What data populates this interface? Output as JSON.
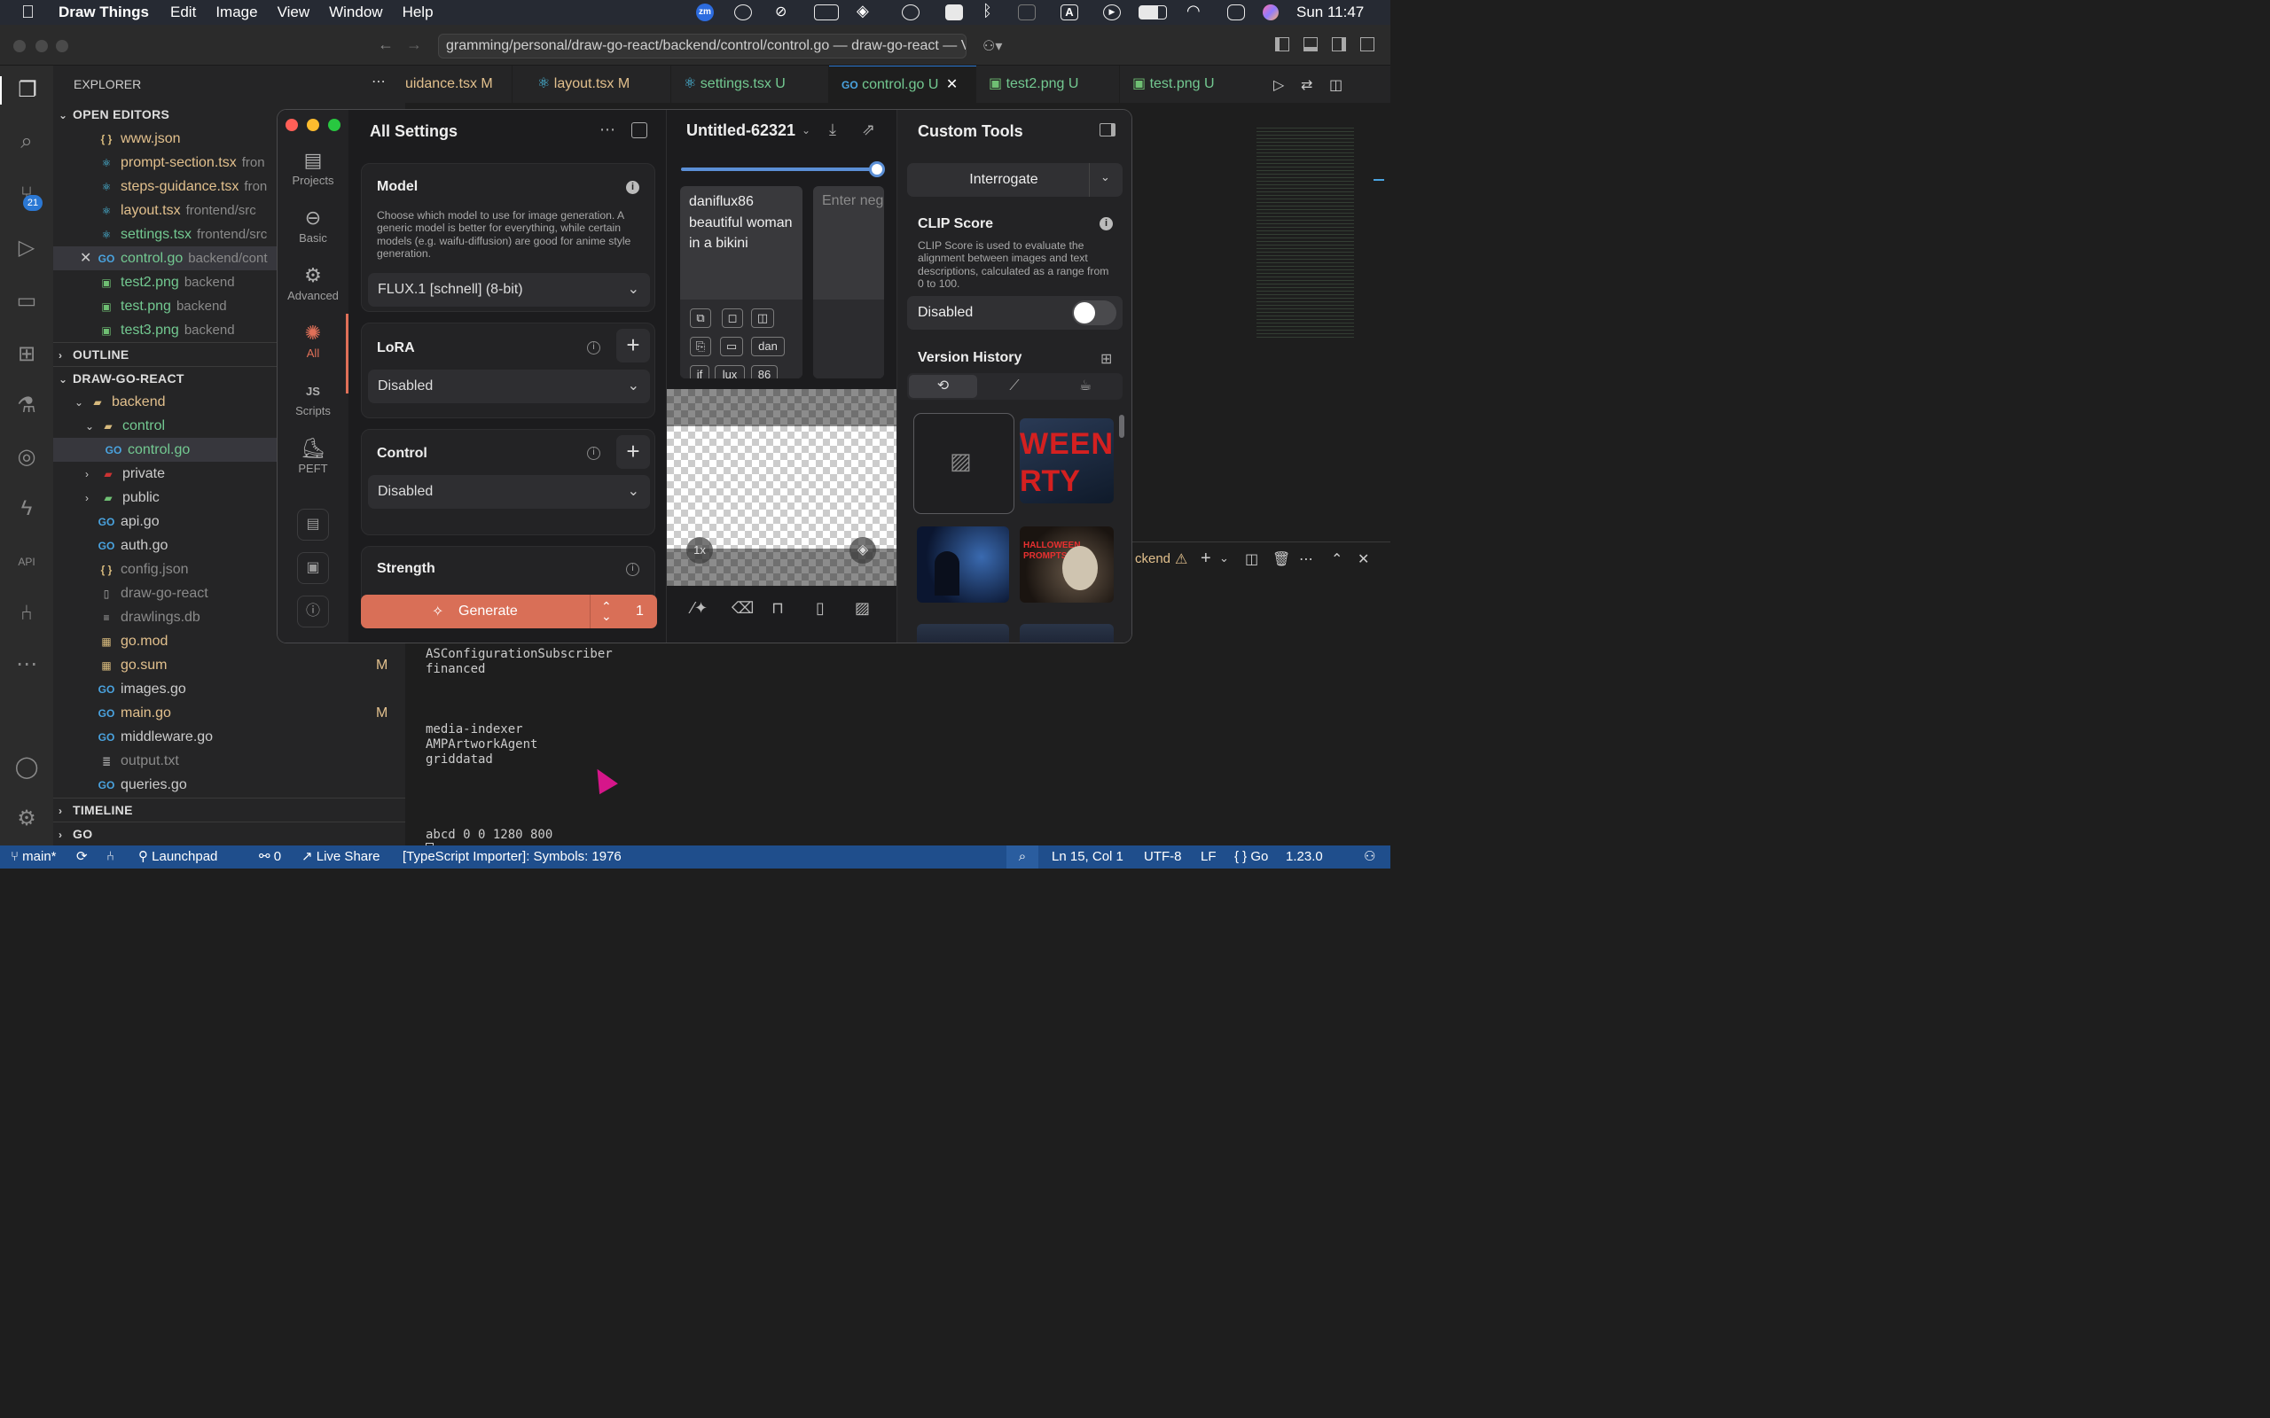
{
  "menubar": {
    "app_name": "Draw Things",
    "items": [
      "Edit",
      "Image",
      "View",
      "Window",
      "Help"
    ],
    "clock": "Sun 11:47",
    "zoom_badge": "zm"
  },
  "vscode": {
    "title": "gramming/personal/draw-go-react/backend/control/control.go — draw-go-react — Visu",
    "scm_badge": "21",
    "explorer_title": "EXPLORER",
    "open_editors_title": "OPEN EDITORS",
    "open_editors": [
      {
        "name": "www.json",
        "type": "json",
        "path": ""
      },
      {
        "name": "prompt-section.tsx",
        "type": "react",
        "path": "fron"
      },
      {
        "name": "steps-guidance.tsx",
        "type": "react",
        "path": "fron"
      },
      {
        "name": "layout.tsx",
        "type": "react",
        "path": "frontend/src"
      },
      {
        "name": "settings.tsx",
        "type": "react",
        "path": "frontend/src"
      },
      {
        "name": "control.go",
        "type": "go",
        "path": "backend/cont"
      },
      {
        "name": "test2.png",
        "type": "image",
        "path": "backend"
      },
      {
        "name": "test.png",
        "type": "image",
        "path": "backend"
      },
      {
        "name": "test3.png",
        "type": "image",
        "path": "backend"
      }
    ],
    "outline_title": "OUTLINE",
    "project_title": "DRAW-GO-REACT",
    "tree": [
      {
        "name": "backend",
        "kind": "folder-open",
        "depth": 1,
        "badge": ""
      },
      {
        "name": "control",
        "kind": "folder-open",
        "depth": 2,
        "badge": ""
      },
      {
        "name": "control.go",
        "kind": "go",
        "depth": 3,
        "badge": ""
      },
      {
        "name": "private",
        "kind": "folder",
        "depth": 2,
        "badge": ""
      },
      {
        "name": "public",
        "kind": "folder",
        "depth": 2,
        "badge": ""
      },
      {
        "name": "api.go",
        "kind": "go",
        "depth": 2,
        "badge": ""
      },
      {
        "name": "auth.go",
        "kind": "go",
        "depth": 2,
        "badge": ""
      },
      {
        "name": "config.json",
        "kind": "json",
        "depth": 2,
        "badge": ""
      },
      {
        "name": "draw-go-react",
        "kind": "file",
        "depth": 2,
        "badge": ""
      },
      {
        "name": "drawlings.db",
        "kind": "db",
        "depth": 2,
        "badge": ""
      },
      {
        "name": "go.mod",
        "kind": "gomod",
        "depth": 2,
        "badge": ""
      },
      {
        "name": "go.sum",
        "kind": "gomod",
        "depth": 2,
        "badge": "M"
      },
      {
        "name": "images.go",
        "kind": "go",
        "depth": 2,
        "badge": ""
      },
      {
        "name": "main.go",
        "kind": "go",
        "depth": 2,
        "badge": "M"
      },
      {
        "name": "middleware.go",
        "kind": "go",
        "depth": 2,
        "badge": ""
      },
      {
        "name": "output.txt",
        "kind": "file",
        "depth": 2,
        "badge": ""
      },
      {
        "name": "queries.go",
        "kind": "go",
        "depth": 2,
        "badge": ""
      }
    ],
    "timeline_title": "TIMELINE",
    "go_title": "GO",
    "tabs": [
      {
        "label": "uidance.tsx",
        "badge": "M",
        "type": "react"
      },
      {
        "label": "layout.tsx",
        "badge": "M",
        "type": "react"
      },
      {
        "label": "settings.tsx",
        "badge": "U",
        "type": "react"
      },
      {
        "label": "control.go",
        "badge": "U",
        "type": "go"
      },
      {
        "label": "test2.png",
        "badge": "U",
        "type": "image"
      },
      {
        "label": "test.png",
        "badge": "U",
        "type": "image"
      }
    ],
    "terminal_tab": "ckend",
    "terminal_lines": [
      "ASConfigurationSubscriber",
      "financed",
      "",
      "",
      "",
      "media-indexer",
      "AMPArtworkAgent",
      "griddatad",
      "",
      "",
      "",
      "",
      "abcd 0 0 1280 800"
    ],
    "status": {
      "branch": "main*",
      "launchpad": "Launchpad",
      "ports": "0",
      "live_share": "Live Share",
      "importer": "[TypeScript Importer]: Symbols: 1976",
      "position": "Ln 15, Col 1",
      "encoding": "UTF-8",
      "eol": "LF",
      "language": "Go",
      "version": "1.23.0"
    }
  },
  "drawthings": {
    "rail": [
      {
        "label": "Projects",
        "icon": "projects-icon"
      },
      {
        "label": "Basic",
        "icon": "basic-icon"
      },
      {
        "label": "Advanced",
        "icon": "advanced-icon"
      },
      {
        "label": "All",
        "icon": "all-icon"
      },
      {
        "label": "Scripts",
        "icon": "scripts-icon"
      },
      {
        "label": "PEFT",
        "icon": "peft-icon"
      }
    ],
    "settings_title": "All Settings",
    "model": {
      "title": "Model",
      "description": "Choose which model to use for image generation. A generic model is better for everything, while certain models (e.g. waifu-diffusion) are good for anime style generation.",
      "value": "FLUX.1 [schnell] (8-bit)"
    },
    "lora": {
      "title": "LoRA",
      "value": "Disabled"
    },
    "control": {
      "title": "Control",
      "value": "Disabled"
    },
    "strength": {
      "title": "Strength"
    },
    "generate": {
      "label": "Generate",
      "count": "1"
    },
    "project_name": "Untitled-62321",
    "prompt": "daniflux86 beautiful woman in a bikini",
    "negative_placeholder": "Enter neg",
    "chips": [
      "dan",
      "if",
      "lux",
      "86"
    ],
    "zoom_label": "1x",
    "tools_title": "Custom Tools",
    "interrogate": "Interrogate",
    "clip": {
      "title": "CLIP Score",
      "description": "CLIP Score is used to evaluate the alignment between images and text descriptions, calculated as a range from 0 to 100.",
      "toggle_label": "Disabled"
    },
    "version_history_title": "Version History",
    "thumbs": [
      {
        "caption": "WEEN",
        "subcaption": "RTY"
      },
      {
        "caption": "HALLOWEEN",
        "subcaption": "PROMPTS"
      }
    ]
  }
}
